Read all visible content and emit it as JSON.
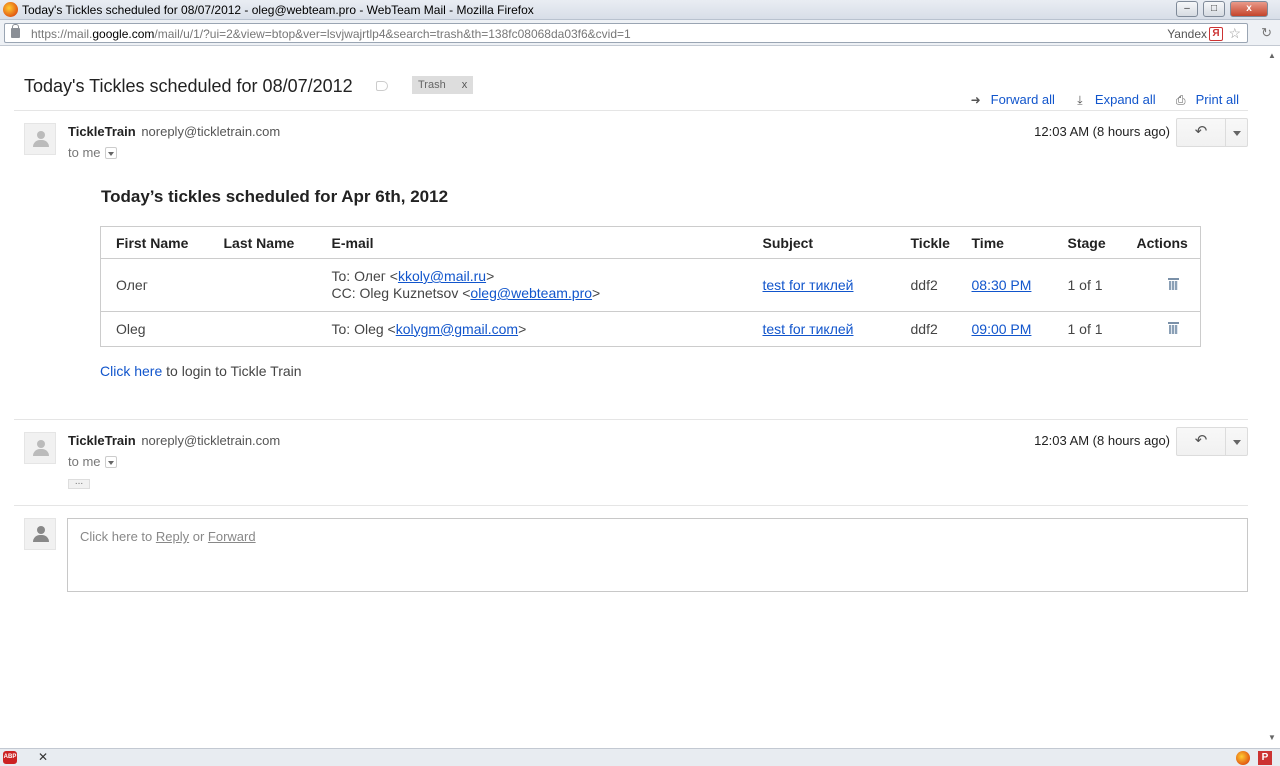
{
  "window": {
    "title": "Today's Tickles scheduled for 08/07/2012 - oleg@webteam.pro - WebTeam Mail - Mozilla Firefox",
    "minimize": "–",
    "maximize": "□",
    "close": "x"
  },
  "urlbar": {
    "url_prefix": "https://mail.",
    "url_domain": "google.com",
    "url_rest": "/mail/u/1/?ui=2&view=btop&ver=lsvjwajrtlp4&search=trash&th=138fc08068da03f6&cvid=1",
    "search_engine": "Yandex",
    "yandex_glyph": "Я",
    "star": "☆",
    "reload": "↻"
  },
  "thread": {
    "subject": "Today's Tickles scheduled for 08/07/2012",
    "tag": "Trash",
    "tag_remove": "x",
    "actions": [
      {
        "label": "Forward all",
        "icon": "➜"
      },
      {
        "label": "Expand all",
        "icon": "⤓"
      },
      {
        "label": "Print all",
        "icon": "⎙"
      }
    ]
  },
  "messages": [
    {
      "sender_name": "TickleTrain",
      "sender_email": "noreply@tickletrain.com",
      "recipient": "to me",
      "time": "12:03 AM (8 hours ago)",
      "reply_icon": "↶"
    },
    {
      "sender_name": "TickleTrain",
      "sender_email": "noreply@tickletrain.com",
      "recipient": "to me",
      "time": "12:03 AM (8 hours ago)",
      "reply_icon": "↶",
      "collapsed_marker": "..."
    }
  ],
  "email_body": {
    "heading": "Today’s tickles scheduled for Apr 6th, 2012",
    "columns": [
      "First Name",
      "Last Name",
      "E-mail",
      "Subject",
      "Tickle",
      "Time",
      "Stage",
      "Actions"
    ],
    "rows": [
      {
        "first_name": "Олег",
        "last_name": "",
        "to_prefix": "To: Олег <",
        "to_email": "kkoly@mail.ru",
        "to_suffix": ">",
        "cc_prefix": "CC: Oleg Kuznetsov <",
        "cc_email": "oleg@webteam.pro",
        "cc_suffix": ">",
        "subject": "test for тиклей",
        "tickle": "ddf2",
        "time": "08:30 PM",
        "stage": "1 of 1"
      },
      {
        "first_name": "Oleg",
        "last_name": "",
        "to_prefix": "To: Oleg <",
        "to_email": "kolygm@gmail.com",
        "to_suffix": ">",
        "subject": "test for тиклей",
        "tickle": "ddf2",
        "time": "09:00 PM",
        "stage": "1 of 1"
      }
    ],
    "login_link": "Click here",
    "login_text": " to login to Tickle Train"
  },
  "reply_box": {
    "prefix": "Click here to ",
    "reply": "Reply",
    "middle": " or ",
    "forward": "Forward"
  },
  "statusbar": {
    "abp": "ABP",
    "close": "✕",
    "p_icon": "P"
  }
}
